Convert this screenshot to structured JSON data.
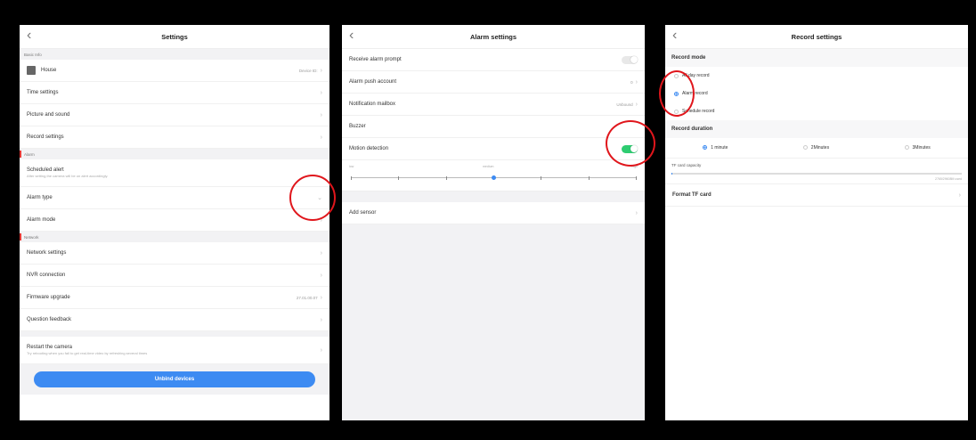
{
  "settings": {
    "title": "Settings",
    "back": "‹",
    "basic_info_header": "Basic Info",
    "house_label": "House",
    "device_id_label": "Device ID:",
    "items_basic": [
      {
        "label": "Time settings"
      },
      {
        "label": "Picture and sound"
      },
      {
        "label": "Record settings"
      }
    ],
    "alarm_header": "Alarm",
    "scheduled_alert_label": "Scheduled alert",
    "scheduled_alert_sub": "After setting,the camera will be on alert accordingly.",
    "alarm_type_label": "Alarm type",
    "alarm_mode_label": "Alarm mode",
    "network_header": "Network",
    "network_settings_label": "Network settings",
    "nvr_label": "NVR connection",
    "firmware_label": "Firmware upgrade",
    "firmware_value": "27.01.00.07",
    "feedback_label": "Question feedback",
    "restart_label": "Restart the camera",
    "restart_sub": "Try rebooting when you fail to get real-time video by refreshing several times",
    "unbind_label": "Unbind devices",
    "chevron": "›",
    "chevron_down": "⌄"
  },
  "alarm": {
    "title": "Alarm settings",
    "back": "‹",
    "receive_prompt_label": "Receive alarm prompt",
    "receive_prompt_on": false,
    "push_account_label": "Alarm  push account",
    "push_account_value": "0",
    "mailbox_label": "Notification mailbox",
    "mailbox_value": "Unbound",
    "buzzer_label": "Buzzer",
    "motion_label": "Motion detection",
    "motion_on": true,
    "sensitivity_low": "low",
    "sensitivity_medium": "medium",
    "sensitivity_high": "high",
    "sensitivity_value": 0.5,
    "add_sensor_label": "Add sensor",
    "chevron": "›"
  },
  "record": {
    "title": "Record settings",
    "back": "‹",
    "record_mode_header": "Record mode",
    "mode_options": [
      {
        "label": "All day record",
        "selected": false
      },
      {
        "label": "Alarm record",
        "selected": true
      },
      {
        "label": "Schedule record",
        "selected": false
      }
    ],
    "duration_header": "Record duration",
    "duration_options": [
      {
        "label": "1 minute",
        "selected": true
      },
      {
        "label": "2Minutes",
        "selected": false
      },
      {
        "label": "3Minutes",
        "selected": false
      }
    ],
    "tf_capacity_label": "TF card capacity",
    "tf_capacity_used": "2765/29608M used",
    "tf_capacity_fraction": 0.003,
    "format_label": "Format TF card",
    "chevron": "›"
  },
  "colors": {
    "accent": "#3d8bf2",
    "toggle_on": "#2ecc71",
    "highlight_circle": "#e0161c",
    "background": "#000000"
  }
}
